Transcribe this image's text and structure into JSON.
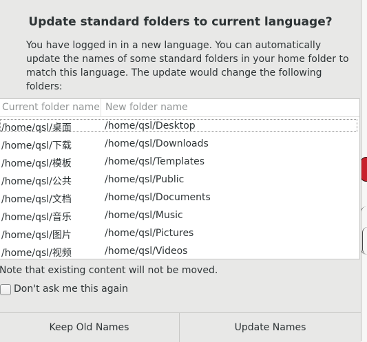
{
  "dialog": {
    "title": "Update standard folders to current language?",
    "description": "You have logged in in a new language. You can automatically update the names of some standard folders in your home folder to match this language. The update would change the following folders:",
    "table": {
      "headers": [
        "Current folder name",
        "New folder name"
      ],
      "rows": [
        {
          "current": "/home/qsl/桌面",
          "new": "/home/qsl/Desktop"
        },
        {
          "current": "/home/qsl/下载",
          "new": "/home/qsl/Downloads"
        },
        {
          "current": "/home/qsl/模板",
          "new": "/home/qsl/Templates"
        },
        {
          "current": "/home/qsl/公共",
          "new": "/home/qsl/Public"
        },
        {
          "current": "/home/qsl/文档",
          "new": "/home/qsl/Documents"
        },
        {
          "current": "/home/qsl/音乐",
          "new": "/home/qsl/Music"
        },
        {
          "current": "/home/qsl/图片",
          "new": "/home/qsl/Pictures"
        },
        {
          "current": "/home/qsl/视频",
          "new": "/home/qsl/Videos"
        }
      ]
    },
    "note": "Note that existing content will not be moved.",
    "checkbox": {
      "label": "Don't ask me this again",
      "checked": false
    },
    "buttons": {
      "keep": "Keep Old Names",
      "update": "Update Names"
    }
  },
  "colors": {
    "dialog_bg": "#e8e8e7",
    "text": "#2e3436",
    "header_text": "#929595",
    "accent_red": "#c8202b"
  }
}
